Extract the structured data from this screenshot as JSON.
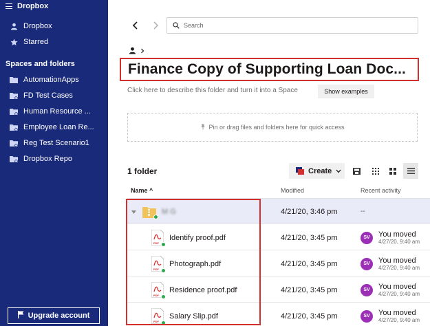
{
  "sidebar": {
    "app_name": "Dropbox",
    "nav": [
      {
        "label": "Dropbox",
        "icon": "person-icon"
      },
      {
        "label": "Starred",
        "icon": "star-icon"
      }
    ],
    "section_title": "Spaces and folders",
    "folders": [
      {
        "label": "AutomationApps",
        "icon": "folder-icon"
      },
      {
        "label": "FD Test Cases",
        "icon": "shared-folder-icon"
      },
      {
        "label": "Human Resource ...",
        "icon": "shared-folder-icon"
      },
      {
        "label": "Employee Loan Re...",
        "icon": "shared-folder-icon"
      },
      {
        "label": "Reg Test Scenario1",
        "icon": "shared-folder-icon"
      },
      {
        "label": "Dropbox Repo",
        "icon": "shared-folder-icon"
      }
    ],
    "upgrade_label": "Upgrade account"
  },
  "search": {
    "placeholder": "Search"
  },
  "page": {
    "title": "Finance Copy of Supporting Loan Doc...",
    "describe": "Click here to describe this folder and turn it into a Space",
    "show_examples": "Show examples",
    "dropzone": "Pin or drag files and folders here for quick access",
    "folder_count": "1 folder",
    "create_label": "Create"
  },
  "table": {
    "headers": {
      "name": "Name",
      "sort_arrow": "^",
      "modified": "Modified",
      "activity": "Recent activity"
    },
    "rows": [
      {
        "name": "M      G      ",
        "type": "folder",
        "modified": "4/21/20, 3:46 pm",
        "activity": "--"
      },
      {
        "name": "Identify proof.pdf",
        "type": "pdf",
        "modified": "4/21/20, 3:45 pm",
        "initials": "SV",
        "activity": "You moved",
        "activity_sub": "4/27/20, 9:40 am"
      },
      {
        "name": "Photograph.pdf",
        "type": "pdf",
        "modified": "4/21/20, 3:45 pm",
        "initials": "SV",
        "activity": "You moved",
        "activity_sub": "4/27/20, 9:40 am"
      },
      {
        "name": "Residence proof.pdf",
        "type": "pdf",
        "modified": "4/21/20, 3:45 pm",
        "initials": "SV",
        "activity": "You moved",
        "activity_sub": "4/27/20, 9:40 am"
      },
      {
        "name": "Salary Slip.pdf",
        "type": "pdf",
        "modified": "4/21/20, 3:45 pm",
        "initials": "SV",
        "activity": "You moved",
        "activity_sub": "4/27/20, 9:40 am"
      }
    ]
  },
  "colors": {
    "sidebar_bg": "#1a2a7a",
    "highlight": "#d32f2f",
    "avatar": "#9b2fb6",
    "selected_row": "#e9ecf8"
  }
}
